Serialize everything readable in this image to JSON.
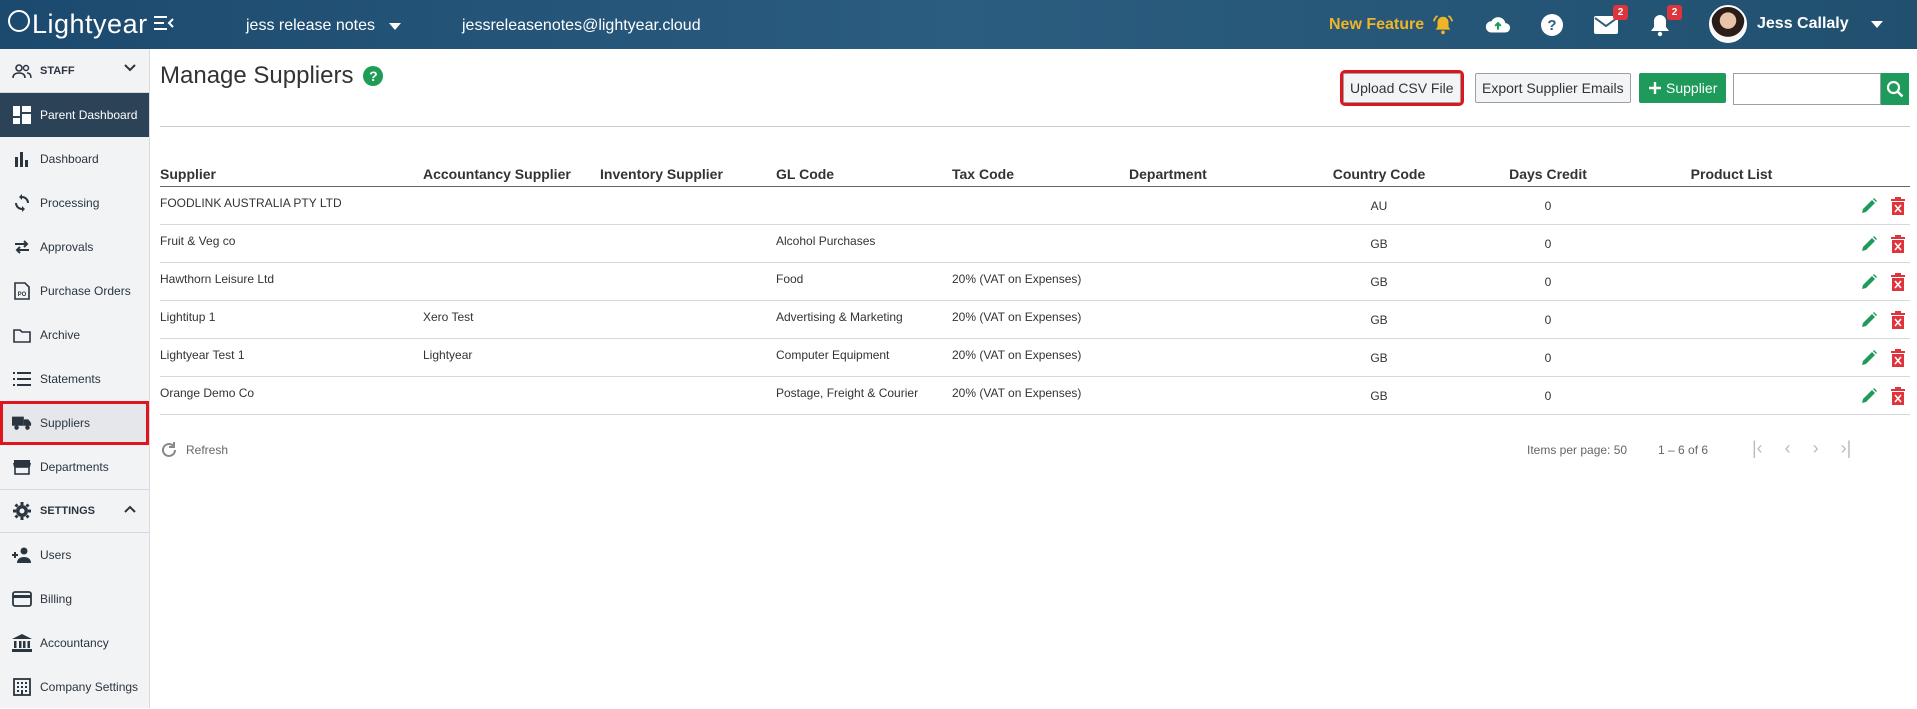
{
  "topbar": {
    "logo_text": "Lightyear",
    "org_name": "jess release notes",
    "org_email": "jessreleasenotes@lightyear.cloud",
    "new_feature_label": "New Feature",
    "mail_badge": "2",
    "bell_badge": "2",
    "user_name": "Jess Callaly"
  },
  "sidebar": {
    "staff_label": "STAFF",
    "settings_label": "SETTINGS",
    "staff_items": [
      {
        "label": "Parent Dashboard",
        "icon": "dashboard-grid-icon"
      },
      {
        "label": "Dashboard",
        "icon": "bar-chart-icon"
      },
      {
        "label": "Processing",
        "icon": "sync-icon"
      },
      {
        "label": "Approvals",
        "icon": "swap-arrows-icon"
      },
      {
        "label": "Purchase Orders",
        "icon": "po-document-icon"
      },
      {
        "label": "Archive",
        "icon": "folder-icon"
      },
      {
        "label": "Statements",
        "icon": "list-icon"
      },
      {
        "label": "Suppliers",
        "icon": "truck-icon"
      },
      {
        "label": "Departments",
        "icon": "store-icon"
      }
    ],
    "settings_items": [
      {
        "label": "Users",
        "icon": "add-user-icon"
      },
      {
        "label": "Billing",
        "icon": "credit-card-icon"
      },
      {
        "label": "Accountancy",
        "icon": "bank-icon"
      },
      {
        "label": "Company Settings",
        "icon": "building-icon"
      }
    ]
  },
  "main": {
    "title": "Manage Suppliers",
    "help_symbol": "?",
    "upload_label": "Upload CSV File",
    "export_label": "Export Supplier Emails",
    "add_label": "Supplier",
    "search_placeholder": ""
  },
  "table": {
    "headers": [
      "Supplier",
      "Accountancy Supplier",
      "Inventory Supplier",
      "GL Code",
      "Tax Code",
      "Department",
      "Country Code",
      "Days Credit",
      "Product List"
    ],
    "rows": [
      {
        "supplier": "FOODLINK AUSTRALIA PTY LTD",
        "accountancy": "",
        "inventory": "",
        "gl": "",
        "tax": "",
        "department": "",
        "country": "AU",
        "days": "0",
        "products": ""
      },
      {
        "supplier": "Fruit & Veg co",
        "accountancy": "",
        "inventory": "",
        "gl": "Alcohol Purchases",
        "tax": "",
        "department": "",
        "country": "GB",
        "days": "0",
        "products": ""
      },
      {
        "supplier": "Hawthorn Leisure Ltd",
        "accountancy": "",
        "inventory": "",
        "gl": "Food",
        "tax": "20% (VAT on Expenses)",
        "department": "",
        "country": "GB",
        "days": "0",
        "products": ""
      },
      {
        "supplier": "Lightitup 1",
        "accountancy": "Xero Test",
        "inventory": "",
        "gl": "Advertising & Marketing",
        "tax": "20% (VAT on Expenses)",
        "department": "",
        "country": "GB",
        "days": "0",
        "products": ""
      },
      {
        "supplier": "Lightyear Test 1",
        "accountancy": "Lightyear",
        "inventory": "",
        "gl": "Computer Equipment",
        "tax": "20% (VAT on Expenses)",
        "department": "",
        "country": "GB",
        "days": "0",
        "products": ""
      },
      {
        "supplier": "Orange Demo Co",
        "accountancy": "",
        "inventory": "",
        "gl": "Postage, Freight & Courier",
        "tax": "20% (VAT on Expenses)",
        "department": "",
        "country": "GB",
        "days": "0",
        "products": ""
      }
    ]
  },
  "footer": {
    "refresh_label": "Refresh",
    "items_per_page": "Items per page: 50",
    "range": "1 – 6 of 6"
  },
  "colors": {
    "accent_green": "#1e9a5a",
    "delete_red": "#e0343c",
    "highlight_red": "#e0141e",
    "new_feature_gold": "#f0b429"
  }
}
